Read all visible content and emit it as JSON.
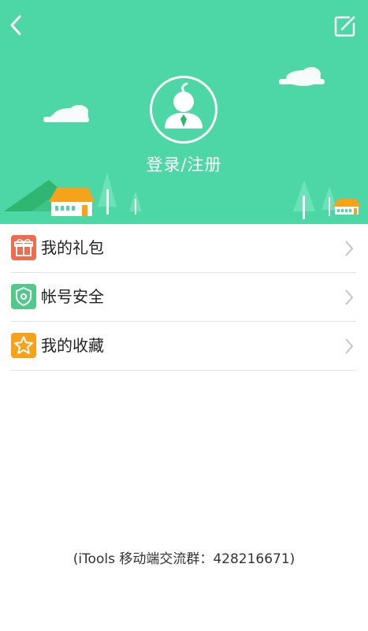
{
  "header": {
    "login_label": "登录/注册",
    "background_color": "#4dd6a6",
    "back_icon": "chevron-left-icon",
    "edit_icon": "edit-note-icon",
    "avatar_icon": "user-avatar-icon"
  },
  "menu": {
    "items": [
      {
        "label": "我的礼包",
        "icon": "gift-icon",
        "icon_color": "#ef6c4f"
      },
      {
        "label": "帐号安全",
        "icon": "shield-icon",
        "icon_color": "#52c98a"
      },
      {
        "label": "我的收藏",
        "icon": "star-icon",
        "icon_color": "#f7a21b"
      }
    ]
  },
  "footer": {
    "text": "(iTools 移动端交流群：428216671)"
  }
}
